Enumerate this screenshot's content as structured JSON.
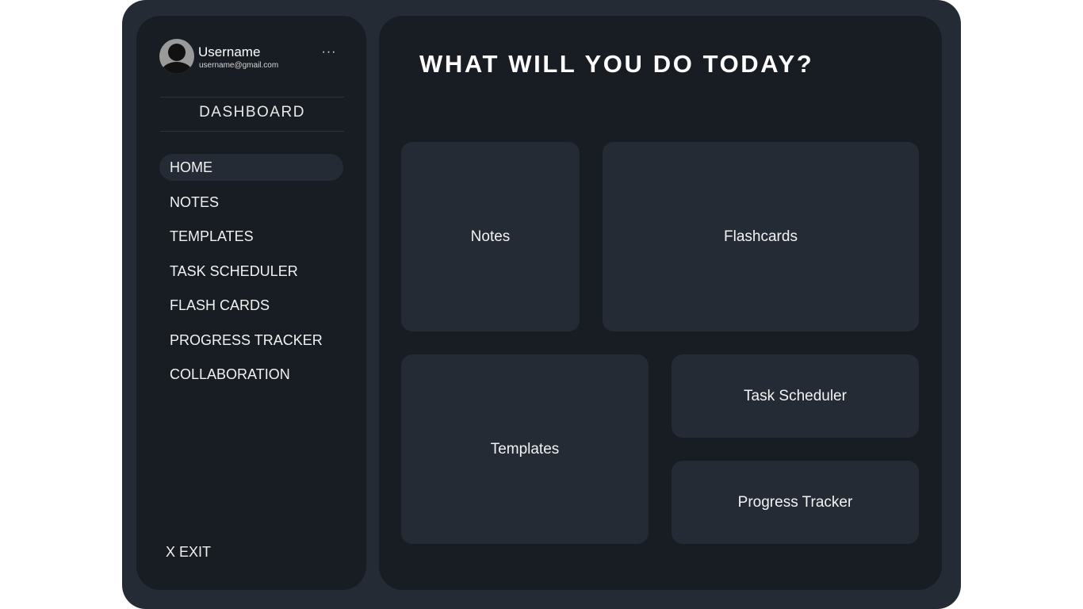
{
  "user": {
    "name": "Username",
    "email": "username@gmail.com",
    "avatar_icon": "user-avatar-icon",
    "more_icon": "more-horizontal-icon",
    "more_glyph": "···"
  },
  "sidebar": {
    "title": "DASHBOARD",
    "items": [
      {
        "label": "HOME",
        "active": true
      },
      {
        "label": "NOTES"
      },
      {
        "label": "TEMPLATES"
      },
      {
        "label": "TASK SCHEDULER"
      },
      {
        "label": "FLASH CARDS"
      },
      {
        "label": "PROGRESS TRACKER"
      },
      {
        "label": "COLLABORATION"
      }
    ],
    "exit_label": "X EXIT"
  },
  "main": {
    "heading": "WHAT WILL YOU DO TODAY?",
    "cards": {
      "notes": "Notes",
      "flashcards": "Flashcards",
      "templates": "Templates",
      "task_scheduler": "Task Scheduler",
      "progress_tracker": "Progress Tracker"
    }
  },
  "colors": {
    "frame": "#252b35",
    "panel": "#181c23",
    "card": "#252b35",
    "text": "#f2f2f2"
  }
}
